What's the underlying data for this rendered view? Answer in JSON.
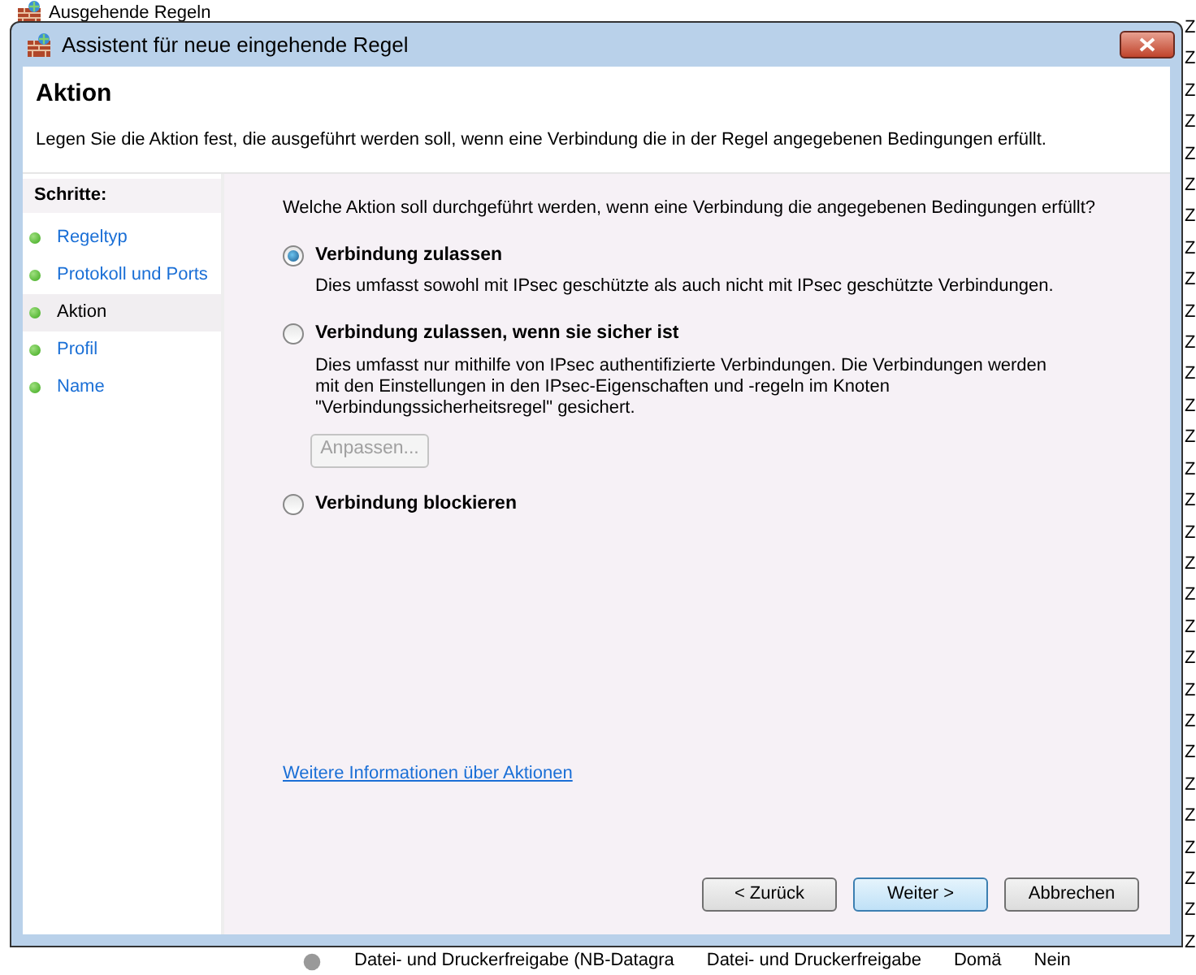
{
  "background": {
    "tree_item": "Ausgehende Regeln",
    "right_column": [
      "Z",
      "Z",
      "Z",
      "Z",
      "Z",
      "Z",
      "Z",
      "Z",
      "Z",
      "Z",
      "Z",
      "Z",
      "Z",
      "Z",
      "Z",
      "Z",
      "Z",
      "Z",
      "Z",
      "Z",
      "Z",
      "Z",
      "Z",
      "Z",
      "Z",
      "Z",
      "Z",
      "Z",
      "Z",
      "Z"
    ],
    "bottom_row": [
      "Datei- und Druckerfreigabe (NB-Datagra",
      "Datei- und Druckerfreigabe",
      "Domä",
      "Nein"
    ]
  },
  "window": {
    "title": "Assistent für neue eingehende Regel"
  },
  "header": {
    "title": "Aktion",
    "description": "Legen Sie die Aktion fest, die ausgeführt werden soll, wenn eine Verbindung die in der Regel angegebenen Bedingungen erfüllt."
  },
  "steps": {
    "heading": "Schritte:",
    "items": [
      {
        "label": "Regeltyp",
        "selected": false
      },
      {
        "label": "Protokoll und Ports",
        "selected": false
      },
      {
        "label": "Aktion",
        "selected": true
      },
      {
        "label": "Profil",
        "selected": false
      },
      {
        "label": "Name",
        "selected": false
      }
    ]
  },
  "question": "Welche Aktion soll durchgeführt werden, wenn eine Verbindung die angegebenen Bedingungen erfüllt?",
  "options": [
    {
      "label": "Verbindung zulassen",
      "selected": true,
      "description": "Dies umfasst sowohl mit IPsec geschützte als auch nicht mit IPsec geschützte Verbindungen."
    },
    {
      "label": "Verbindung zulassen, wenn sie sicher ist",
      "selected": false,
      "description": "Dies umfasst nur mithilfe von IPsec authentifizierte Verbindungen. Die Verbindungen werden mit den Einstellungen in den IPsec-Eigenschaften und -regeln im Knoten \"Verbindungssicherheitsregel\" gesichert.",
      "button": {
        "label": "Anpassen...",
        "disabled": true
      }
    },
    {
      "label": "Verbindung blockieren",
      "selected": false
    }
  ],
  "link": "Weitere Informationen über Aktionen",
  "buttons": [
    {
      "label": "< Zurück",
      "default": false
    },
    {
      "label": "Weiter >",
      "default": true
    },
    {
      "label": "Abbrechen",
      "default": false
    }
  ]
}
